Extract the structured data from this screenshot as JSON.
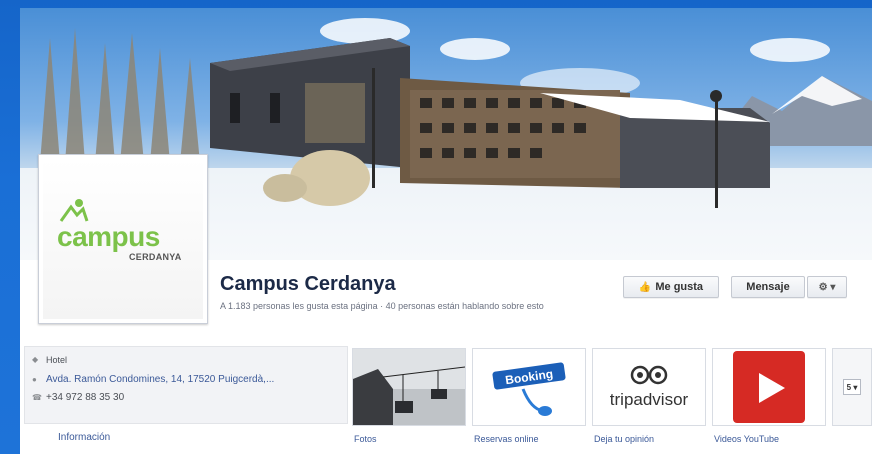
{
  "page": {
    "title": "Campus Cerdanya",
    "likes_summary": "A 1.183 personas les gusta esta página · 40 personas están hablando sobre esto"
  },
  "logo": {
    "word": "campus",
    "sub": "CERDANYA"
  },
  "actions": {
    "like_label": "Me gusta",
    "message_label": "Mensaje",
    "gear_label": "⚙ ▾"
  },
  "info": {
    "category": "Hotel",
    "address": "Avda. Ramón Condomines, 14, 17520 Puigcerdà,...",
    "phone": "+34 972 88 35 30",
    "link": "Información"
  },
  "tiles": [
    {
      "label": "Fotos",
      "icon": "ski-lift-photo"
    },
    {
      "label": "Reservas online",
      "icon": "booking-logo"
    },
    {
      "label": "Deja tu opinión",
      "icon": "tripadvisor-logo"
    },
    {
      "label": "Videos YouTube",
      "icon": "play-icon"
    }
  ],
  "tiles_more": "5 ▾",
  "colors": {
    "link": "#3b5998",
    "brand_green": "#7cc24a",
    "youtube_red": "#d62a24"
  }
}
